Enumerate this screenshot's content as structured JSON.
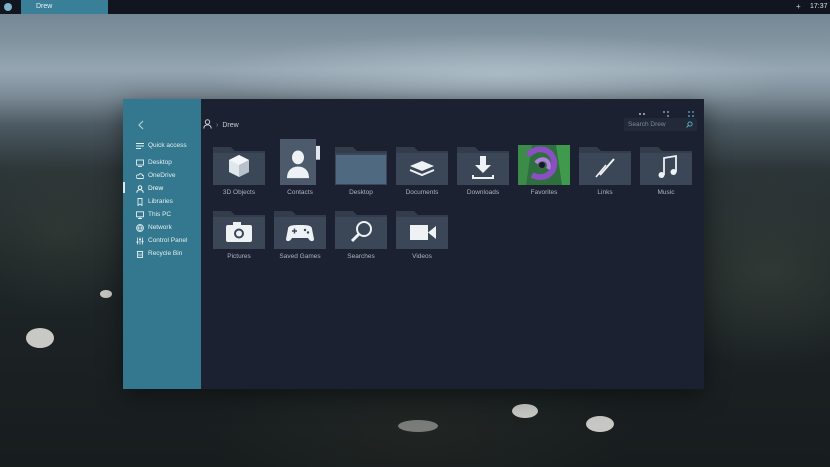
{
  "taskbar": {
    "active_task": "Drew",
    "plus": "+",
    "clock": "17:37"
  },
  "explorer": {
    "back_icon": "back-arrow-icon",
    "breadcrumb": {
      "user_icon": "user-icon",
      "separator": "›",
      "current": "Drew"
    },
    "search": {
      "placeholder": "Search Drew",
      "icon": "search-icon"
    },
    "sidebar": [
      {
        "label": "Quick access",
        "icon": "list-icon"
      },
      {
        "label": "Desktop",
        "icon": "desktop-icon"
      },
      {
        "label": "OneDrive",
        "icon": "cloud-icon"
      },
      {
        "label": "Drew",
        "icon": "user-icon",
        "active": true
      },
      {
        "label": "Libraries",
        "icon": "bookmark-icon"
      },
      {
        "label": "This PC",
        "icon": "monitor-icon"
      },
      {
        "label": "Network",
        "icon": "globe-icon"
      },
      {
        "label": "Control Panel",
        "icon": "sliders-icon"
      },
      {
        "label": "Recycle Bin",
        "icon": "trash-icon"
      }
    ],
    "folders": [
      {
        "label": "3D Objects",
        "icon": "cube-icon"
      },
      {
        "label": "Contacts",
        "icon": "contact-icon"
      },
      {
        "label": "Desktop",
        "icon": "desktop-folder-icon"
      },
      {
        "label": "Documents",
        "icon": "layers-icon"
      },
      {
        "label": "Downloads",
        "icon": "download-icon"
      },
      {
        "label": "Favorites",
        "icon": "favorites-thumbnail"
      },
      {
        "label": "Links",
        "icon": "link-icon"
      },
      {
        "label": "Music",
        "icon": "music-icon"
      },
      {
        "label": "Pictures",
        "icon": "camera-icon"
      },
      {
        "label": "Saved Games",
        "icon": "gamepad-icon"
      },
      {
        "label": "Searches",
        "icon": "magnifier-icon"
      },
      {
        "label": "Videos",
        "icon": "video-icon"
      }
    ],
    "colors": {
      "sidebar": "#34788f",
      "window": "#1b2130",
      "folder": "#3b4656",
      "accent": "#3a7f98"
    }
  }
}
